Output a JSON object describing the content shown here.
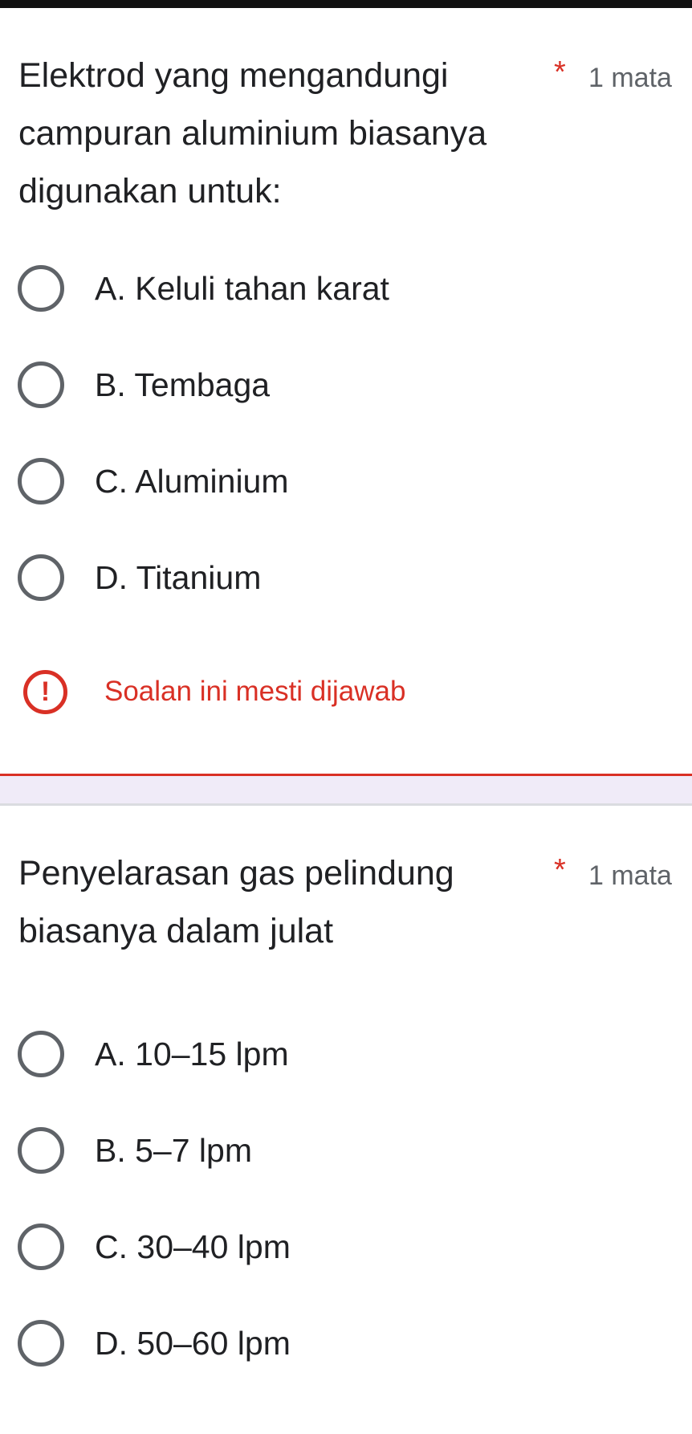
{
  "questions": [
    {
      "title": "Elektrod yang mengandungi campuran aluminium biasanya digunakan untuk:",
      "required_marker": "*",
      "points": "1 mata",
      "options": [
        "A. Keluli tahan karat",
        "B. Tembaga",
        "C. Aluminium",
        "D. Titanium"
      ],
      "error_icon": "exclamation-circle-icon",
      "error_symbol": "!",
      "error_message": "Soalan ini mesti dijawab"
    },
    {
      "title": "Penyelarasan gas pelindung biasanya dalam julat",
      "required_marker": "*",
      "points": "1 mata",
      "options": [
        "A. 10–15 lpm",
        "B. 5–7 lpm",
        "C. 30–40 lpm",
        "D. 50–60 lpm"
      ]
    }
  ],
  "colors": {
    "error": "#d93025",
    "text": "#202124",
    "secondary_text": "#5f6368",
    "separator_bg": "#f0ebf8"
  }
}
